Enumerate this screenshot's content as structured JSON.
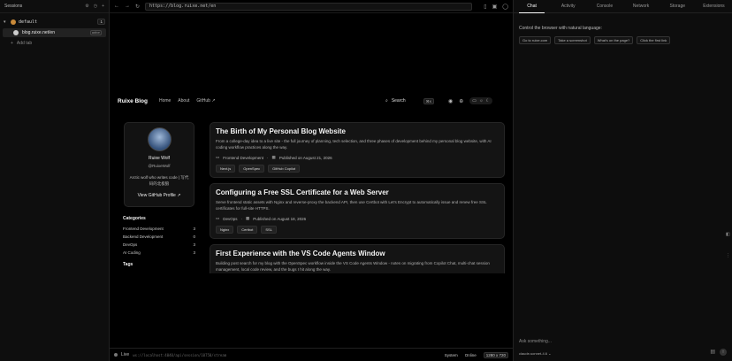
{
  "sessions": {
    "title": "Sessions",
    "group": {
      "name": "default",
      "count": "1"
    },
    "tab": {
      "name": "blog.ruixe.net/en",
      "badge": "active"
    },
    "add_label": "Add tab"
  },
  "browser": {
    "url": "https://blog.ruixe.net/en"
  },
  "blog": {
    "brand": "Ruixe Blog",
    "nav": [
      "Home",
      "About",
      "GitHub ↗"
    ],
    "search_label": "Search",
    "search_kbd": "⌘K",
    "profile": {
      "name": "Ruixe Wolf",
      "handle": "@RuixeWolf",
      "bio": "Arctic wolf who writes code | 写代码的北极狼",
      "github_label": "View GitHub Profile ↗"
    },
    "categories_title": "Categories",
    "categories": [
      {
        "name": "Frontend Development",
        "count": "3"
      },
      {
        "name": "Backend Development",
        "count": "0"
      },
      {
        "name": "DevOps",
        "count": "3"
      },
      {
        "name": "AI Coding",
        "count": "3"
      }
    ],
    "tags_title": "Tags",
    "posts": [
      {
        "title": "The Birth of My Personal Blog Website",
        "desc": "From a college-day idea to a live site - the full journey of planning, tech selection, and three phases of development behind my personal blog website, with AI coding workflow practices along the way.",
        "category": "Frontend Development",
        "date": "Published on August 21, 2026",
        "tags": [
          "Next.js",
          "OpenSpec",
          "GitHub Copilot"
        ]
      },
      {
        "title": "Configuring a Free SSL Certificate for a Web Server",
        "desc": "Serve frontend static assets with Nginx and reverse-proxy the backend API, then use Certbot with Let's Encrypt to automatically issue and renew free SSL certificates for full-site HTTPS.",
        "category": "DevOps",
        "date": "Published on August 18, 2026",
        "tags": [
          "Nginx",
          "Certbot",
          "SSL"
        ]
      },
      {
        "title": "First Experience with the VS Code Agents Window",
        "desc": "Building post search for my blog with the OpenSpec workflow inside the VS Code Agents Window - notes on migrating from Copilot Chat, multi-chat session management, local code review, and the bugs I hit along the way.",
        "category": "",
        "date": "",
        "tags": []
      }
    ]
  },
  "status": {
    "live": "Live",
    "ws": "ws://localhost:4040/api/session/10750/stream",
    "system": "System",
    "online": "Online",
    "resolution": "1280 x 720"
  },
  "panel": {
    "tabs": [
      "Chat",
      "Activity",
      "Console",
      "Network",
      "Storage",
      "Extensions"
    ],
    "hint": "Control the browser with natural language:",
    "chips": [
      "Go to ruixe.com",
      "Take a screenshot",
      "What's on the page?",
      "Click the first link"
    ],
    "ask_placeholder": "Ask something...",
    "model": "claude-sonnet-4.6 ⌄"
  },
  "colors": {
    "bg": "#000000",
    "card": "#141414",
    "accent": "#ffffff"
  }
}
